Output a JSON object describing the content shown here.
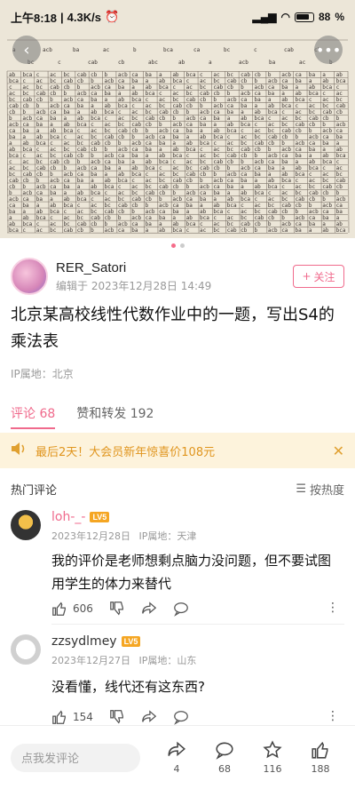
{
  "status_bar": {
    "time": "上午8:18",
    "net_speed": "4.3K/s",
    "battery": "88"
  },
  "image": {
    "page_indicator": 2,
    "page_active": 1
  },
  "author": {
    "name": "RER_Satori",
    "edit_time": "编辑于 2023年12月28日 14:49",
    "follow_label": "关注"
  },
  "post": {
    "title": "北京某高校线性代数作业中的一题，写出S4的乘法表",
    "ip_location": "IP属地：北京"
  },
  "tabs": [
    {
      "label": "评论 68",
      "active": true
    },
    {
      "label": "赞和转发 192",
      "active": false
    }
  ],
  "promo": {
    "text": "最后2天！大会员新年惊喜价108元"
  },
  "hot_comments": {
    "title": "热门评论",
    "sort_label": "按热度"
  },
  "comments": [
    {
      "user": "loh-_-",
      "level": "LV5",
      "date": "2023年12月28日",
      "ip": "IP属地：天津",
      "text": "我的评价是老师想剩点脑力没问题，但不要试图用学生的体力来替代",
      "likes": "606"
    },
    {
      "user": "zzsydlmey",
      "level": "LV5",
      "date": "2023年12月27日",
      "ip": "IP属地：山东",
      "text": "没看懂，线代还有这东西?",
      "likes": "154"
    }
  ],
  "bottom_bar": {
    "input_placeholder": "点我发评论",
    "share_count": "4",
    "comment_count": "68",
    "fav_count": "116",
    "like_count": "188"
  },
  "colors": {
    "accent": "#f06a8c",
    "promo_bg": "#fdf3dc",
    "promo_text": "#e0951e",
    "level_badge": "#f5a623"
  },
  "icons": {
    "back": "chevron-left-icon",
    "more": "more-horizontal-icon",
    "speaker": "speaker-icon",
    "close": "close-icon",
    "sort": "sort-lines-icon",
    "like": "thumb-up-icon",
    "dislike": "thumb-down-icon",
    "share": "share-icon",
    "comment": "comment-bubble-icon",
    "star": "star-icon"
  }
}
